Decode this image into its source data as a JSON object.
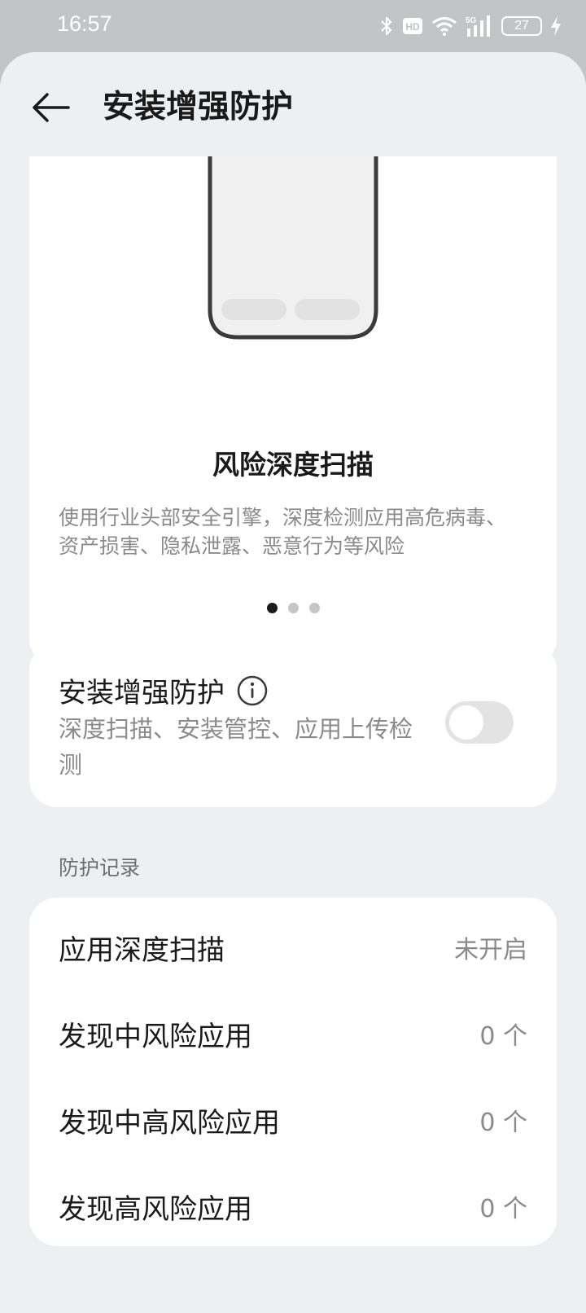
{
  "status_bar": {
    "time": "16:57",
    "network": "5G",
    "hd": "HD",
    "battery": "27"
  },
  "header": {
    "title": "安装增强防护"
  },
  "hero": {
    "title": "风险深度扫描",
    "description": "使用行业头部安全引擎，深度检测应用高危病毒、资产损害、隐私泄露、恶意行为等风险",
    "page_index": 0,
    "page_count": 3
  },
  "protection": {
    "title": "安装增强防护",
    "description": "深度扫描、安装管控、应用上传检测",
    "enabled": false
  },
  "records": {
    "section_label": "防护记录",
    "items": [
      {
        "label": "应用深度扫描",
        "value": "未开启"
      },
      {
        "label": "发现中风险应用",
        "value": "0 个"
      },
      {
        "label": "发现中高风险应用",
        "value": "0 个"
      },
      {
        "label": "发现高风险应用",
        "value": "0 个"
      }
    ]
  },
  "colors": {
    "background": "#eeeff0",
    "card": "#ffffff",
    "text_primary": "#1a1a1a",
    "text_secondary": "#8a8a8a",
    "toggle_off": "#e3e3e3"
  }
}
